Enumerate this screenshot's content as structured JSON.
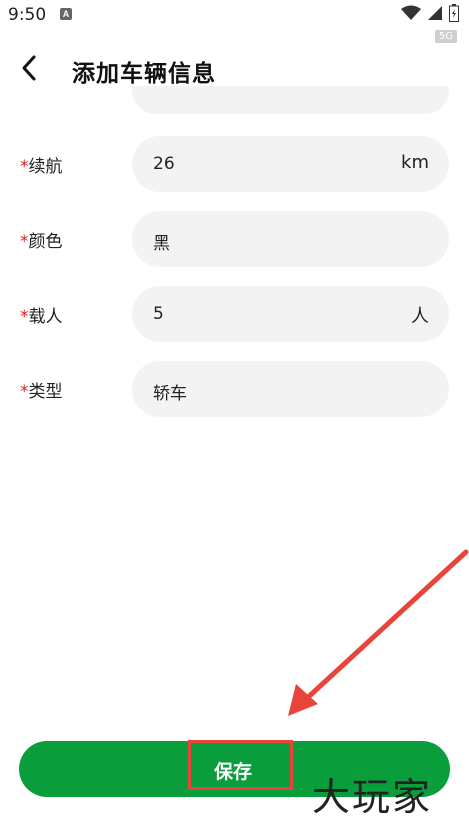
{
  "status_bar": {
    "time": "9:50",
    "notification_letter": "A",
    "network_badge": "5G"
  },
  "header": {
    "title": "添加车辆信息"
  },
  "form": {
    "required_mark": "*",
    "rows": [
      {
        "label": "续航",
        "value": "26",
        "unit": "km"
      },
      {
        "label": "颜色",
        "value": "黑",
        "unit": ""
      },
      {
        "label": "载人",
        "value": "5",
        "unit": "人"
      },
      {
        "label": "类型",
        "value": "轿车",
        "unit": ""
      }
    ]
  },
  "save_button": {
    "label": "保存"
  },
  "watermark": {
    "text": "大玩家"
  },
  "colors": {
    "accent_green": "#0a9d3c",
    "required_red": "#e02020",
    "annotation_red": "#e8443a",
    "field_bg": "#f3f3f3"
  }
}
